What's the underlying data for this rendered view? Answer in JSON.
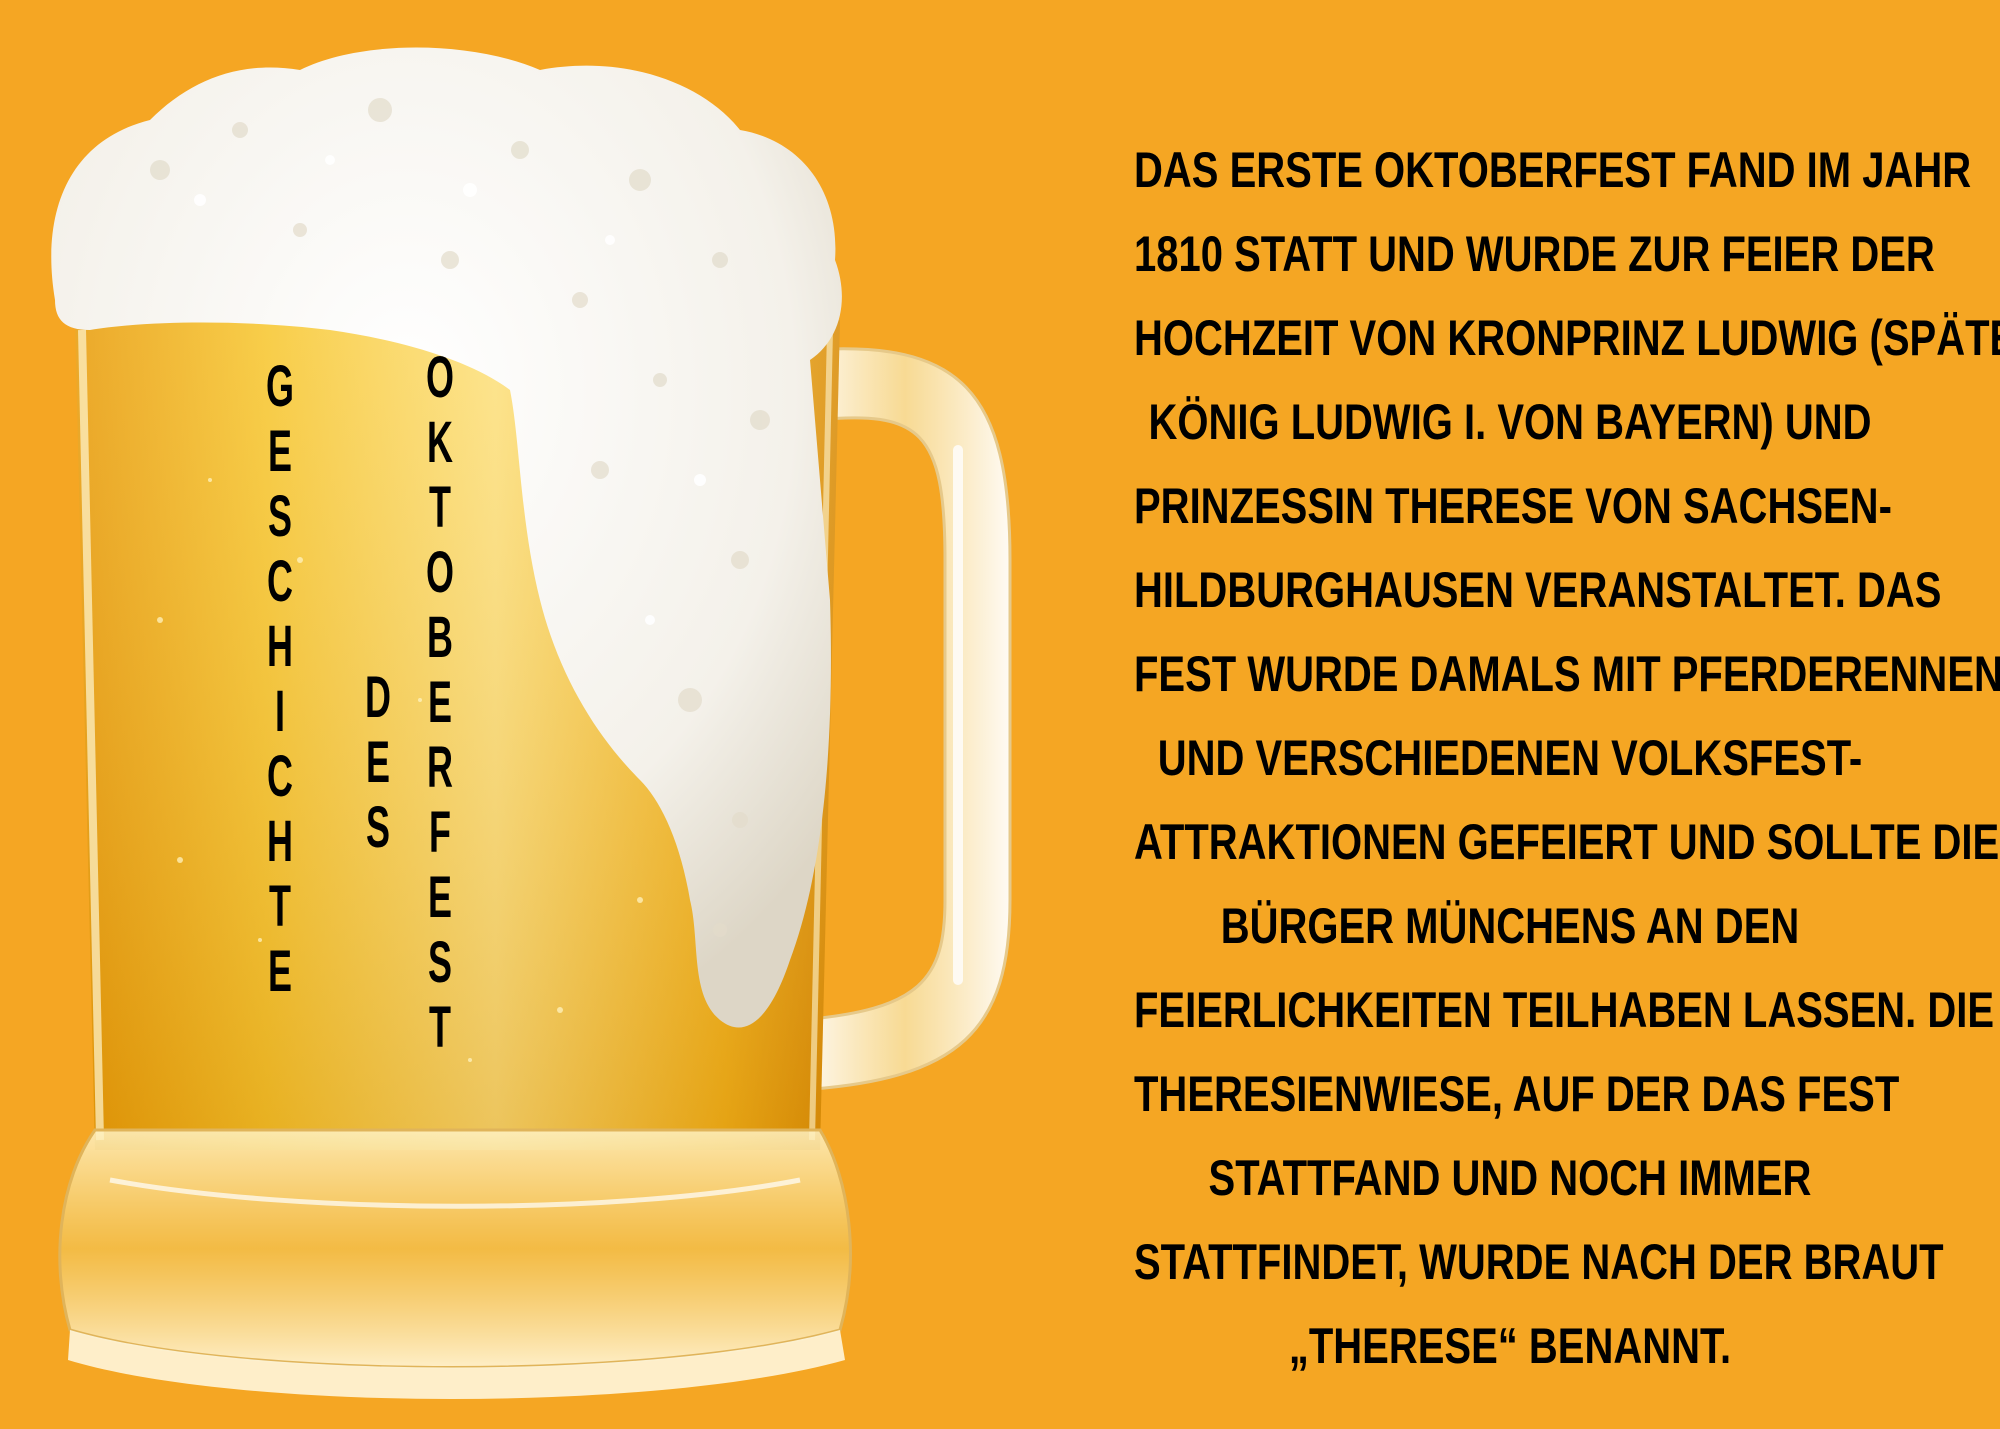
{
  "colors": {
    "background": "#f5a623",
    "text": "#000000",
    "beer": "#f6b40c",
    "foam": "#f6f2ea"
  },
  "title": {
    "words": [
      "GESCHICHTE",
      "DES",
      "OKTOBERFEST"
    ]
  },
  "body": {
    "lines": [
      "DAS ERSTE OKTOBERFEST FAND IM JAHR",
      "1810 STATT UND WURDE ZUR FEIER DER",
      "HOCHZEIT VON KRONPRINZ LUDWIG (SPÄTER",
      "KÖNIG LUDWIG I. VON BAYERN) UND",
      "PRINZESSIN THERESE VON SACHSEN-",
      "HILDBURGHAUSEN VERANSTALTET. DAS",
      "FEST WURDE DAMALS MIT PFERDERENNEN",
      "UND VERSCHIEDENEN VOLKSFEST-",
      "ATTRAKTIONEN GEFEIERT UND SOLLTE DIE",
      "BÜRGER MÜNCHENS AN DEN",
      "FEIERLICHKEITEN TEILHABEN LASSEN. DIE",
      "THERESIENWIESE, AUF DER DAS FEST",
      "STATTFAND UND NOCH IMMER",
      "STATTFINDET, WURDE NACH DER BRAUT",
      "„THERESE“ BENANNT."
    ]
  }
}
